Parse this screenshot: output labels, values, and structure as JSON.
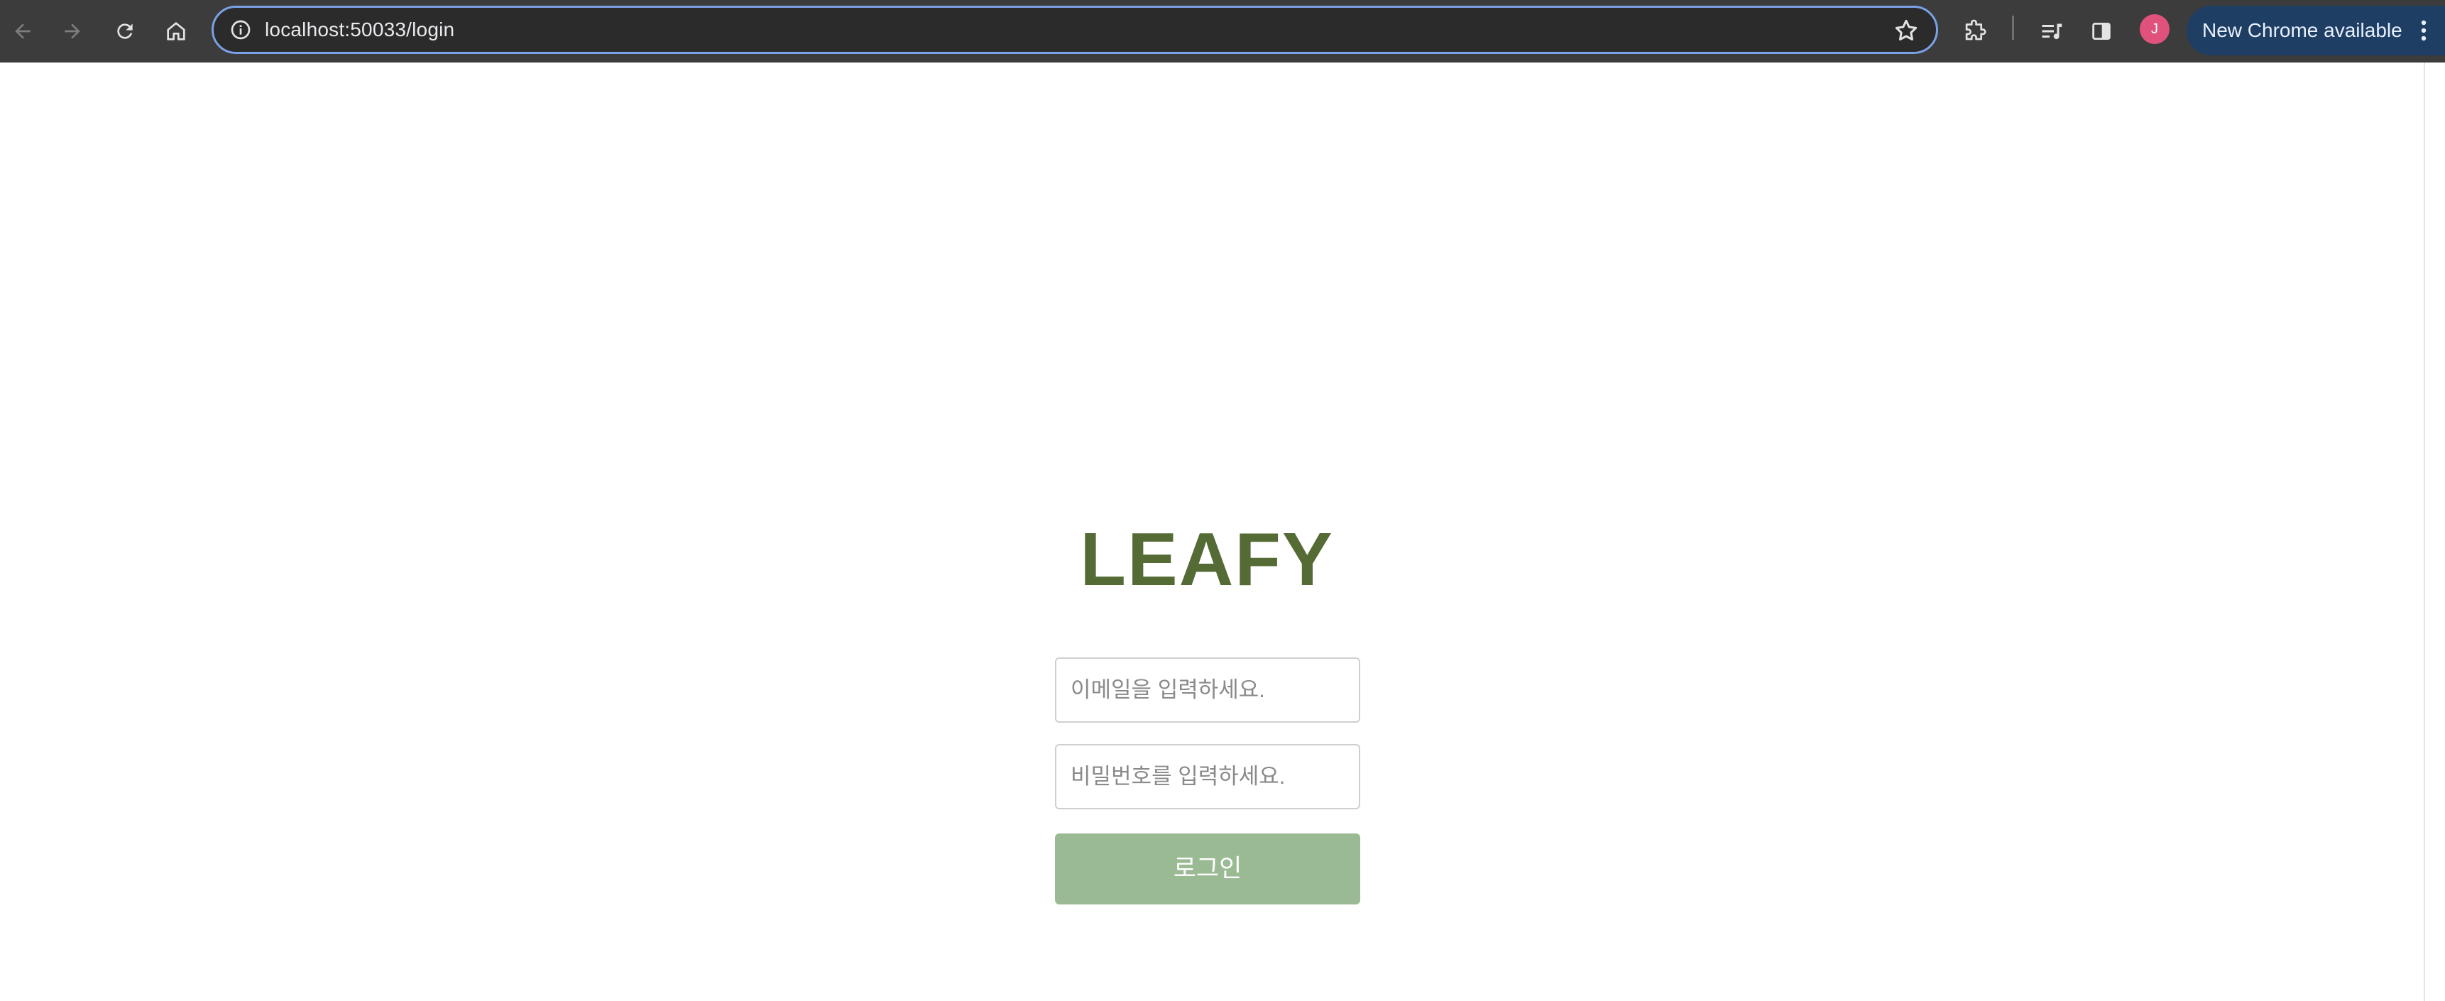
{
  "browser": {
    "url": "localhost:50033/login",
    "profile_initial": "J",
    "update_label": "New Chrome available",
    "colors": {
      "toolbar": "#3c3c3c",
      "omnibox_focus": "#7aa1e6",
      "avatar": "#e0527c",
      "update_pill": "#1f3e63"
    },
    "icons": [
      "back-icon",
      "forward-icon",
      "reload-icon",
      "home-icon",
      "site-info-icon",
      "bookmark-star-icon",
      "extensions-icon",
      "reading-list-icon",
      "side-panel-icon",
      "kebab-menu-icon"
    ]
  },
  "page": {
    "brand": "LEAFY",
    "email_placeholder": "이메일을 입력하세요.",
    "password_placeholder": "비밀번호를 입력하세요.",
    "login_label": "로그인",
    "colors": {
      "brand": "#556b35",
      "button": "#9aba93",
      "button_text": "#ffffff"
    }
  }
}
